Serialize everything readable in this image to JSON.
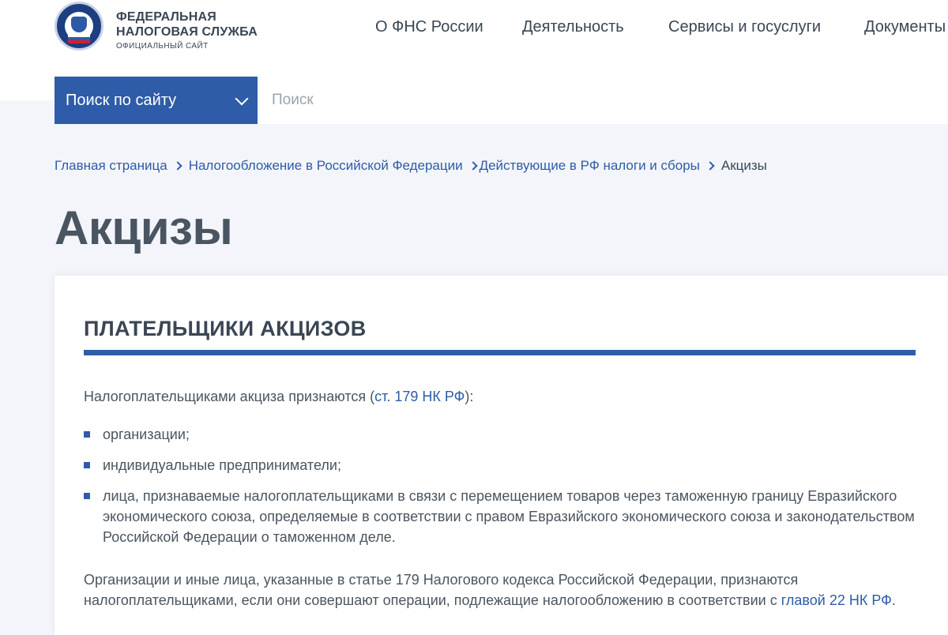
{
  "header": {
    "brand_line1": "ФЕДЕРАЛЬНАЯ",
    "brand_line2": "НАЛОГОВАЯ СЛУЖБА",
    "brand_sub": "ОФИЦИАЛЬНЫЙ САЙТ",
    "logo_icon": "fns-emblem-icon",
    "nav": [
      {
        "label": "О ФНС России"
      },
      {
        "label": "Деятельность"
      },
      {
        "label": "Сервисы и госуслуги"
      },
      {
        "label": "Документы"
      }
    ]
  },
  "search": {
    "scope_label": "Поиск по сайту",
    "placeholder": "Поиск",
    "value": ""
  },
  "breadcrumb": {
    "items": [
      {
        "label": "Главная страница"
      },
      {
        "label": "Налогообложение в Российской Федерации"
      },
      {
        "label": "Действующие в РФ налоги и сборы"
      }
    ],
    "current": "Акцизы"
  },
  "page": {
    "title": "Акцизы",
    "section_title": "ПЛАТЕЛЬЩИКИ АКЦИЗОВ",
    "intro_before": "Налогоплательщиками акциза признаются (",
    "intro_link": "ст. 179 НК РФ",
    "intro_after": "):",
    "list": [
      "организации;",
      "индивидуальные предприниматели;",
      "лица, признаваемые налогоплательщиками в связи с перемещением товаров через таможенную границу Евразийского экономического союза, определяемые в соответствии с правом Евразийского экономического союза и законодательством Российской Федерации о таможенном деле."
    ],
    "outro_before": "Организации и иные лица, указанные в статье 179 Налогового кодекса Российской Федерации, признаются налогоплательщиками, если они совершают операции, подлежащие налогообложению в соответствии с ",
    "outro_link": "главой 22 НК РФ",
    "outro_after": "."
  },
  "colors": {
    "accent": "#2e5ca8",
    "text": "#4a5560",
    "background": "#f3f5fa"
  }
}
